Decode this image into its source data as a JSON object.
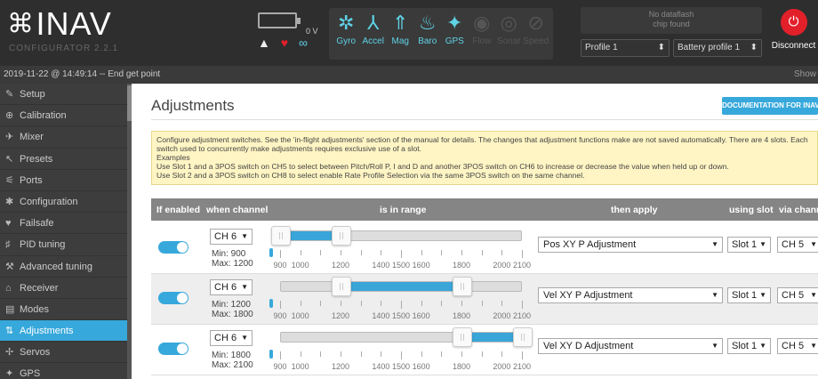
{
  "app": {
    "logo_mark": "⌘",
    "logo_name": "INAV",
    "logo_sub": "CONFIGURATOR  2.2.1"
  },
  "header": {
    "battery_voltage": "0 V",
    "sensors": [
      {
        "label": "Gyro",
        "icon": "gyro-icon",
        "active": true
      },
      {
        "label": "Accel",
        "icon": "accel-icon",
        "active": true
      },
      {
        "label": "Mag",
        "icon": "mag-icon",
        "active": true
      },
      {
        "label": "Baro",
        "icon": "baro-icon",
        "active": true
      },
      {
        "label": "GPS",
        "icon": "gps-icon",
        "active": true
      },
      {
        "label": "Flow",
        "icon": "flow-icon",
        "active": false
      },
      {
        "label": "Sonar",
        "icon": "sonar-icon",
        "active": false
      },
      {
        "label": "Speed",
        "icon": "speed-icon",
        "active": false
      }
    ],
    "dataflash_line1": "No dataflash",
    "dataflash_line2": "chip found",
    "profile": "Profile 1",
    "battery_profile": "Battery profile 1",
    "disconnect_label": "Disconnect"
  },
  "log": {
    "text": "2019-11-22 @ 14:49:14 -- End get point",
    "show_label": "Show"
  },
  "sidebar": {
    "items": [
      {
        "label": "Setup",
        "icon": "wrench-icon"
      },
      {
        "label": "Calibration",
        "icon": "calibration-icon"
      },
      {
        "label": "Mixer",
        "icon": "mixer-icon"
      },
      {
        "label": "Presets",
        "icon": "presets-icon"
      },
      {
        "label": "Ports",
        "icon": "ports-icon"
      },
      {
        "label": "Configuration",
        "icon": "gear-icon"
      },
      {
        "label": "Failsafe",
        "icon": "failsafe-icon"
      },
      {
        "label": "PID tuning",
        "icon": "pid-icon"
      },
      {
        "label": "Advanced tuning",
        "icon": "advanced-tuning-icon"
      },
      {
        "label": "Receiver",
        "icon": "receiver-icon"
      },
      {
        "label": "Modes",
        "icon": "modes-icon"
      },
      {
        "label": "Adjustments",
        "icon": "adjustments-icon",
        "active": true
      },
      {
        "label": "Servos",
        "icon": "servos-icon"
      },
      {
        "label": "GPS",
        "icon": "gps-icon"
      }
    ]
  },
  "page": {
    "title": "Adjustments",
    "doc_button": "DOCUMENTATION FOR INAV",
    "note_line1": "Configure adjustment switches. See the 'in-flight adjustments' section of the manual for details. The changes that adjustment functions make are not saved automatically. There are 4 slots. Each switch used to concurrently make adjustments requires exclusive use of a slot.",
    "note_line2": "Examples",
    "note_line3": "Use Slot 1 and a 3POS switch on CH5 to select between Pitch/Roll P, I and D and another 3POS switch on CH6 to increase or decrease the value when held up or down.",
    "note_line4": "Use Slot 2 and a 3POS switch on CH8 to select enable Rate Profile Selection via the same 3POS switch on the same channel."
  },
  "table": {
    "headers": {
      "enabled": "If enabled",
      "when": "when channel",
      "range": "is in range",
      "apply": "then apply",
      "slot": "using slot",
      "via": "via channel"
    },
    "scale_labels": [
      "900",
      "1000",
      "1200",
      "1400",
      "1500",
      "1600",
      "1800",
      "2000",
      "2100"
    ],
    "rows": [
      {
        "enabled": true,
        "channel": "CH 6",
        "min": "Min: 900",
        "max": "Max: 1200",
        "range_min": 900,
        "range_max": 1200,
        "function": "Pos XY P Adjustment",
        "slot": "Slot 1",
        "via": "CH 5"
      },
      {
        "enabled": true,
        "channel": "CH 6",
        "min": "Min: 1200",
        "max": "Max: 1800",
        "range_min": 1200,
        "range_max": 1800,
        "function": "Vel XY P Adjustment",
        "slot": "Slot 1",
        "via": "CH 5"
      },
      {
        "enabled": true,
        "channel": "CH 6",
        "min": "Min: 1800",
        "max": "Max: 2100",
        "range_min": 1800,
        "range_max": 2100,
        "function": "Vel XY D Adjustment",
        "slot": "Slot 1",
        "via": "CH 5"
      }
    ]
  }
}
